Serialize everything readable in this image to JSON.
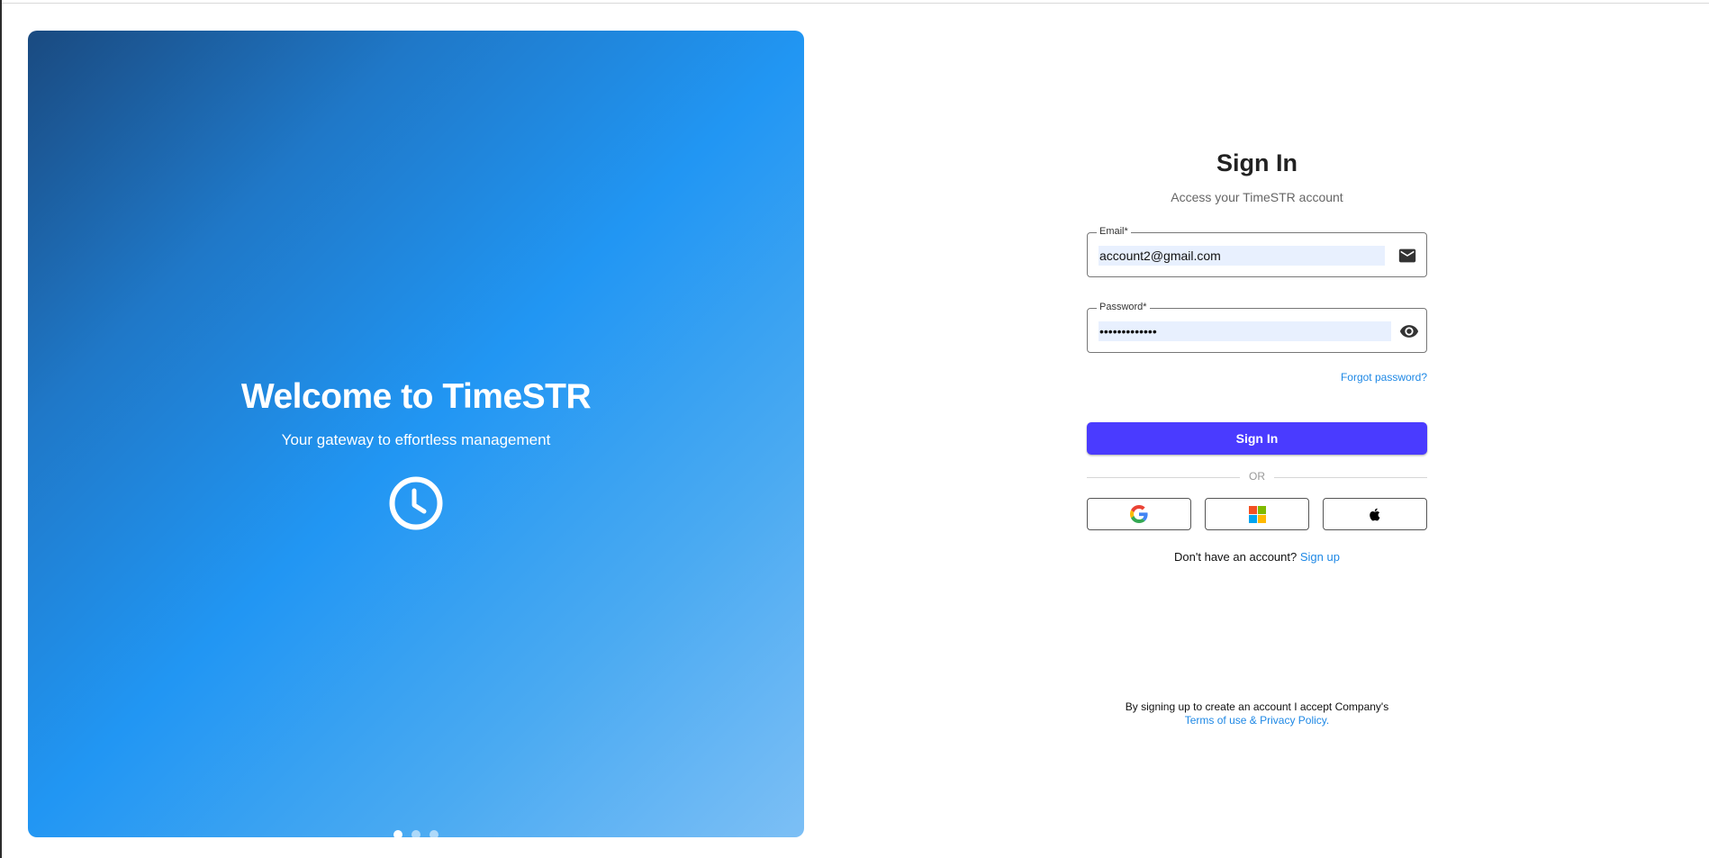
{
  "hero": {
    "title": "Welcome to TimeSTR",
    "subtitle": "Your gateway to effortless management",
    "icon": "clock-icon",
    "carousel": {
      "slides": 3,
      "active": 1
    }
  },
  "signin": {
    "title": "Sign In",
    "subtitle": "Access your TimeSTR account",
    "email": {
      "label": "Email*",
      "value": "account2@gmail.com",
      "icon": "mail-icon"
    },
    "password": {
      "label": "Password*",
      "value": "•••••••••••••",
      "icon": "eye-icon"
    },
    "forgot_label": "Forgot password?",
    "button_label": "Sign In",
    "or_label": "OR",
    "social": [
      {
        "name": "google",
        "icon": "google-icon"
      },
      {
        "name": "microsoft",
        "icon": "microsoft-icon"
      },
      {
        "name": "apple",
        "icon": "apple-icon"
      }
    ],
    "signup_prompt": "Don't have an account?",
    "signup_link": "Sign up"
  },
  "legal": {
    "line1": "By signing up to create an account I accept Company's",
    "link": "Terms of use & Privacy Policy."
  },
  "colors": {
    "accent": "#4a3bff",
    "link": "#1e88e5",
    "hero_start": "#1a4a80",
    "hero_mid": "#2196f3",
    "hero_end": "#7cbff5",
    "autofill": "#e8f0fe"
  }
}
